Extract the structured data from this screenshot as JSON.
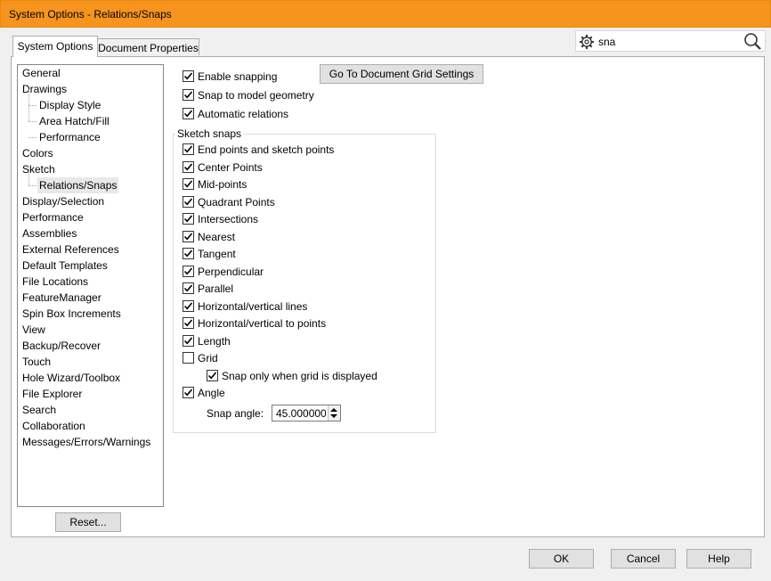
{
  "window": {
    "title": "System Options - Relations/Snaps"
  },
  "tabs": {
    "system": "System Options",
    "document": "Document Properties"
  },
  "search": {
    "value": "sna"
  },
  "tree": [
    "General",
    "Drawings",
    "Display Style",
    "Area Hatch/Fill",
    "Performance",
    "Colors",
    "Sketch",
    "Relations/Snaps",
    "Display/Selection",
    "Performance",
    "Assemblies",
    "External References",
    "Default Templates",
    "File Locations",
    "FeatureManager",
    "Spin Box Increments",
    "View",
    "Backup/Recover",
    "Touch",
    "Hole Wizard/Toolbox",
    "File Explorer",
    "Search",
    "Collaboration",
    "Messages/Errors/Warnings"
  ],
  "buttons": {
    "reset": "Reset...",
    "grid_settings": "Go To Document Grid Settings",
    "ok": "OK",
    "cancel": "Cancel",
    "help": "Help"
  },
  "options": {
    "enable_snapping": {
      "label": "Enable snapping",
      "checked": true
    },
    "snap_model": {
      "label": "Snap to model geometry",
      "checked": true
    },
    "auto_relations": {
      "label": "Automatic relations",
      "checked": true
    }
  },
  "sketch_snaps": {
    "title": "Sketch snaps",
    "items": [
      {
        "label": "End points and sketch points",
        "checked": true
      },
      {
        "label": "Center Points",
        "checked": true
      },
      {
        "label": "Mid-points",
        "checked": true
      },
      {
        "label": "Quadrant Points",
        "checked": true
      },
      {
        "label": "Intersections",
        "checked": true
      },
      {
        "label": "Nearest",
        "checked": true
      },
      {
        "label": "Tangent",
        "checked": true
      },
      {
        "label": "Perpendicular",
        "checked": true
      },
      {
        "label": "Parallel",
        "checked": true
      },
      {
        "label": "Horizontal/vertical lines",
        "checked": true
      },
      {
        "label": "Horizontal/vertical to points",
        "checked": true
      },
      {
        "label": "Length",
        "checked": true
      },
      {
        "label": "Grid",
        "checked": false
      },
      {
        "label": "Snap only when grid is displayed",
        "checked": true
      },
      {
        "label": "Angle",
        "checked": true
      }
    ],
    "snap_angle_label": "Snap angle:",
    "snap_angle_value": "45.0000000"
  }
}
